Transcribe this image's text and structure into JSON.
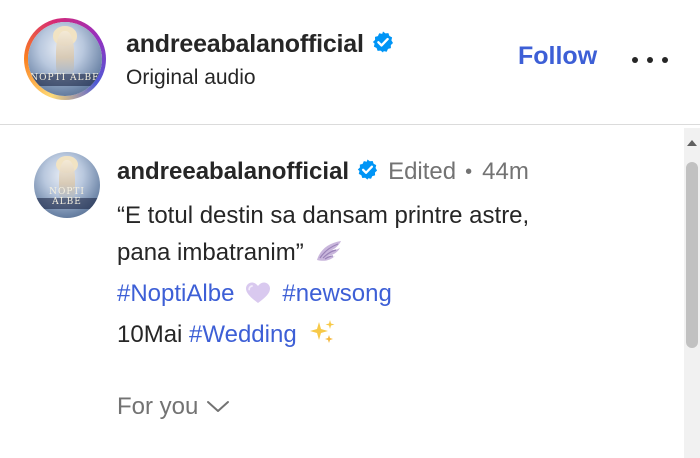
{
  "header": {
    "username": "andreeabalanofficial",
    "subtitle": "Original audio",
    "follow_label": "Follow",
    "avatar_text": "NOPTI ALBE"
  },
  "comment": {
    "username": "andreeabalanofficial",
    "edited_label": "Edited",
    "separator": "•",
    "time": "44m",
    "line1": "“E totul destin sa dansam printre astre,",
    "line2_text": "pana imbatranim”",
    "line2_emoji": "wing",
    "hashtag1": "#NoptiAlbe",
    "heart_emoji": "light-purple-heart",
    "hashtag2": "#newsong",
    "date_text": "10Mai",
    "hashtag3": "#Wedding",
    "sparkles_emoji": "sparkles",
    "avatar_text": "NOPTI ALBE"
  },
  "feed": {
    "for_you_label": "For you"
  },
  "colors": {
    "link": "#3d5fd6",
    "verified": "#0095f6",
    "muted": "#737373",
    "text": "#262626"
  }
}
